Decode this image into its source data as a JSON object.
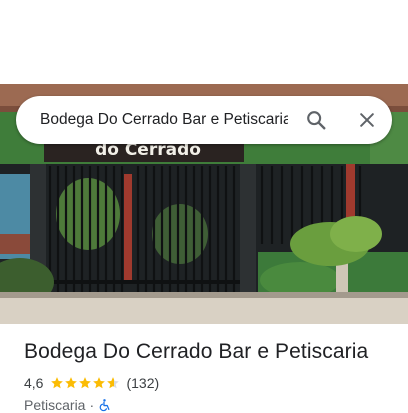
{
  "search": {
    "query": "Bodega Do Cerrado Bar e Petiscaria"
  },
  "photo": {
    "sign_text": "do Cerrado"
  },
  "place": {
    "name": "Bodega Do Cerrado Bar e Petiscaria",
    "rating": "4,6",
    "rating_value": 4.6,
    "reviews": "(132)",
    "category": "Petiscaria",
    "separator": "·",
    "accessibility_icon": "wheelchair-icon"
  },
  "colors": {
    "star": "#fbbc04",
    "accessibility": "#1a73e8",
    "facade_green": "#3f7d3a"
  }
}
